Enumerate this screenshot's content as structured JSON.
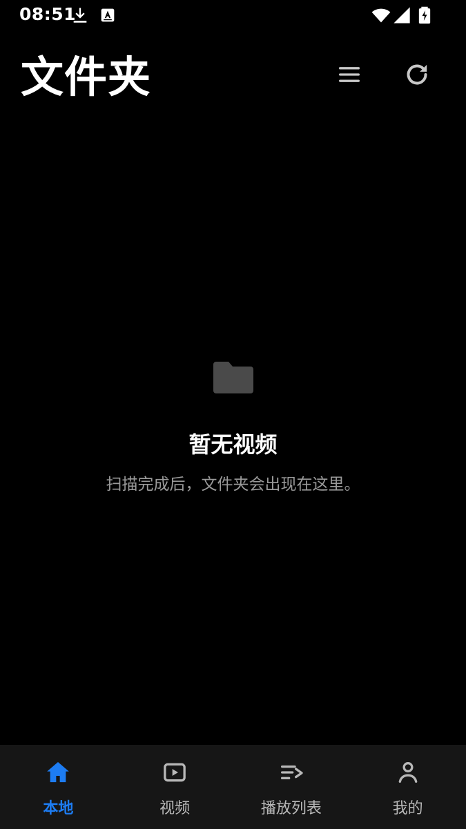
{
  "status_bar": {
    "time": "08:51",
    "icons": [
      "download-icon",
      "keyboard-a-icon",
      "wifi-icon",
      "signal-icon",
      "battery-charging-icon"
    ]
  },
  "header": {
    "title": "文件夹",
    "actions": [
      "menu-icon",
      "refresh-icon"
    ]
  },
  "empty_state": {
    "icon": "folder-icon",
    "title": "暂无视频",
    "subtitle": "扫描完成后，文件夹会出现在这里。"
  },
  "bottom_nav": {
    "items": [
      {
        "label": "本地",
        "icon": "home-icon",
        "active": true
      },
      {
        "label": "视频",
        "icon": "video-icon",
        "active": false
      },
      {
        "label": "播放列表",
        "icon": "playlist-icon",
        "active": false
      },
      {
        "label": "我的",
        "icon": "profile-icon",
        "active": false
      }
    ]
  },
  "colors": {
    "background": "#000000",
    "accent": "#1d7cf2",
    "nav_background": "#161616",
    "muted_text": "#9a9a9a",
    "icon_gray": "#c8c8c8"
  }
}
